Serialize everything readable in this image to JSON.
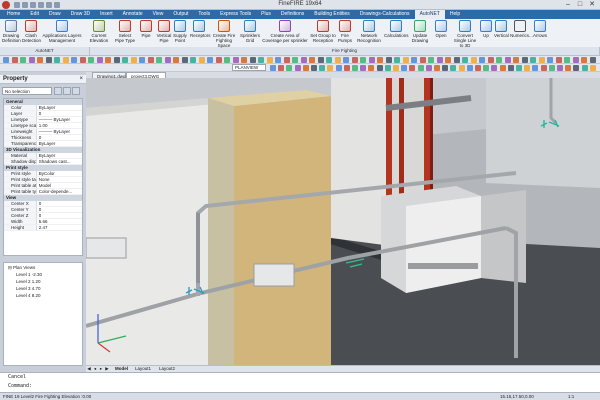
{
  "window": {
    "title": "FineFIRE 19x64"
  },
  "menu": [
    "Home",
    "Edit",
    "Draw",
    "Draw 3D",
    "Insert",
    "Annotate",
    "View",
    "Output",
    "Tools",
    "Express Tools",
    "Plus",
    "Definitions",
    "Building Entities",
    "Drawings-Calculations",
    "AutoNET",
    "Help"
  ],
  "menu_active": "AutoNET",
  "ribbon": {
    "tools": [
      {
        "label": "Drawing Definition",
        "icon": "drawing-definition-icon"
      },
      {
        "label": "Clash Detection",
        "icon": "clash-detection-icon"
      },
      {
        "label": "Applications Layers Management",
        "icon": "layers-management-icon"
      },
      {
        "label": "Current Elevation",
        "icon": "elevation-icon"
      },
      {
        "label": "Select Pipe Type",
        "icon": "pipe-type-icon"
      },
      {
        "label": "Pipe",
        "icon": "pipe-icon"
      },
      {
        "label": "Vertical Pipe",
        "icon": "vertical-pipe-icon"
      },
      {
        "label": "Supply Point",
        "icon": "supply-point-icon"
      },
      {
        "label": "Receptors",
        "icon": "receptors-icon"
      },
      {
        "label": "Create Fire Fighting Space",
        "icon": "fire-space-icon"
      },
      {
        "label": "Sprinklers Grid",
        "icon": "sprinklers-grid-icon"
      },
      {
        "label": "Create Area of Coverage per sprinkler",
        "icon": "coverage-area-icon"
      },
      {
        "label": "Set Group to Reception",
        "icon": "group-reception-icon"
      },
      {
        "label": "Fire Pumps",
        "icon": "fire-pumps-icon"
      },
      {
        "label": "Network Recognition",
        "icon": "network-recognition-icon"
      },
      {
        "label": "Calculations",
        "icon": "calculations-icon"
      },
      {
        "label": "Update Drawing",
        "icon": "update-drawing-icon"
      },
      {
        "label": "Open",
        "icon": "open-icon"
      },
      {
        "label": "Convert Single Line to 3D",
        "icon": "convert-3d-icon"
      },
      {
        "label": "Up",
        "icon": "up-icon"
      },
      {
        "label": "Vertical",
        "icon": "vertical-icon"
      },
      {
        "label": "Numerics...",
        "icon": "numerics-icon"
      },
      {
        "label": "Arrows",
        "icon": "arrows-icon"
      }
    ],
    "groups": [
      {
        "label": "AutoNET"
      },
      {
        "label": "Fire Fighting"
      }
    ]
  },
  "toolbar": {
    "view_combo": "PLANVIEW"
  },
  "document_tabs": [
    {
      "label": "Drawing1.dwg"
    },
    {
      "label": "project3.DWG"
    }
  ],
  "properties": {
    "title": "Property",
    "selection": "No selection",
    "sections": [
      {
        "name": "General",
        "rows": [
          {
            "k": "Color",
            "v": "ByLayer"
          },
          {
            "k": "Layer",
            "v": "0"
          },
          {
            "k": "Linetype",
            "v": "——— ByLayer"
          },
          {
            "k": "Linetype scale",
            "v": "1.00"
          },
          {
            "k": "Lineweight",
            "v": "——— ByLayer"
          },
          {
            "k": "Thickness",
            "v": "0"
          },
          {
            "k": "Transparency",
            "v": "ByLayer"
          }
        ]
      },
      {
        "name": "3D Visualization",
        "rows": [
          {
            "k": "Material",
            "v": "ByLayer"
          },
          {
            "k": "Shadow display",
            "v": "Shadows cast..."
          }
        ]
      },
      {
        "name": "Print style",
        "rows": [
          {
            "k": "Print style",
            "v": "ByColor"
          },
          {
            "k": "Print style table",
            "v": "None"
          },
          {
            "k": "Print table atta...",
            "v": "Model"
          },
          {
            "k": "Print table type",
            "v": "Color-depende..."
          }
        ]
      },
      {
        "name": "View",
        "rows": [
          {
            "k": "Center X",
            "v": "0"
          },
          {
            "k": "Center Y",
            "v": "0"
          },
          {
            "k": "Center Z",
            "v": "0"
          },
          {
            "k": "Width",
            "v": "5.66"
          },
          {
            "k": "Height",
            "v": "2.47"
          }
        ]
      }
    ]
  },
  "tree": {
    "root": "Plan Views",
    "items": [
      {
        "label": "Level 1 -2.30"
      },
      {
        "label": "Level 2 1.20"
      },
      {
        "label": "Level 3 4.70"
      },
      {
        "label": "Level 4 8.20"
      }
    ]
  },
  "layout_tabs": [
    "Model",
    "Layout1",
    "Layout2"
  ],
  "command": {
    "history": "Cancel",
    "prompt": "Command:"
  },
  "status": {
    "left": "FINE 19 Level2 Fire Fighting Elevation :0.00",
    "coords": "15.15,17.50,0.00",
    "scale": "1:1"
  },
  "colors": {
    "accent": "#2d6aa8",
    "pipe_red": "#b5341f",
    "column_yellow": "#d2b57a",
    "sprinkler_cyan": "#28b5a0"
  }
}
